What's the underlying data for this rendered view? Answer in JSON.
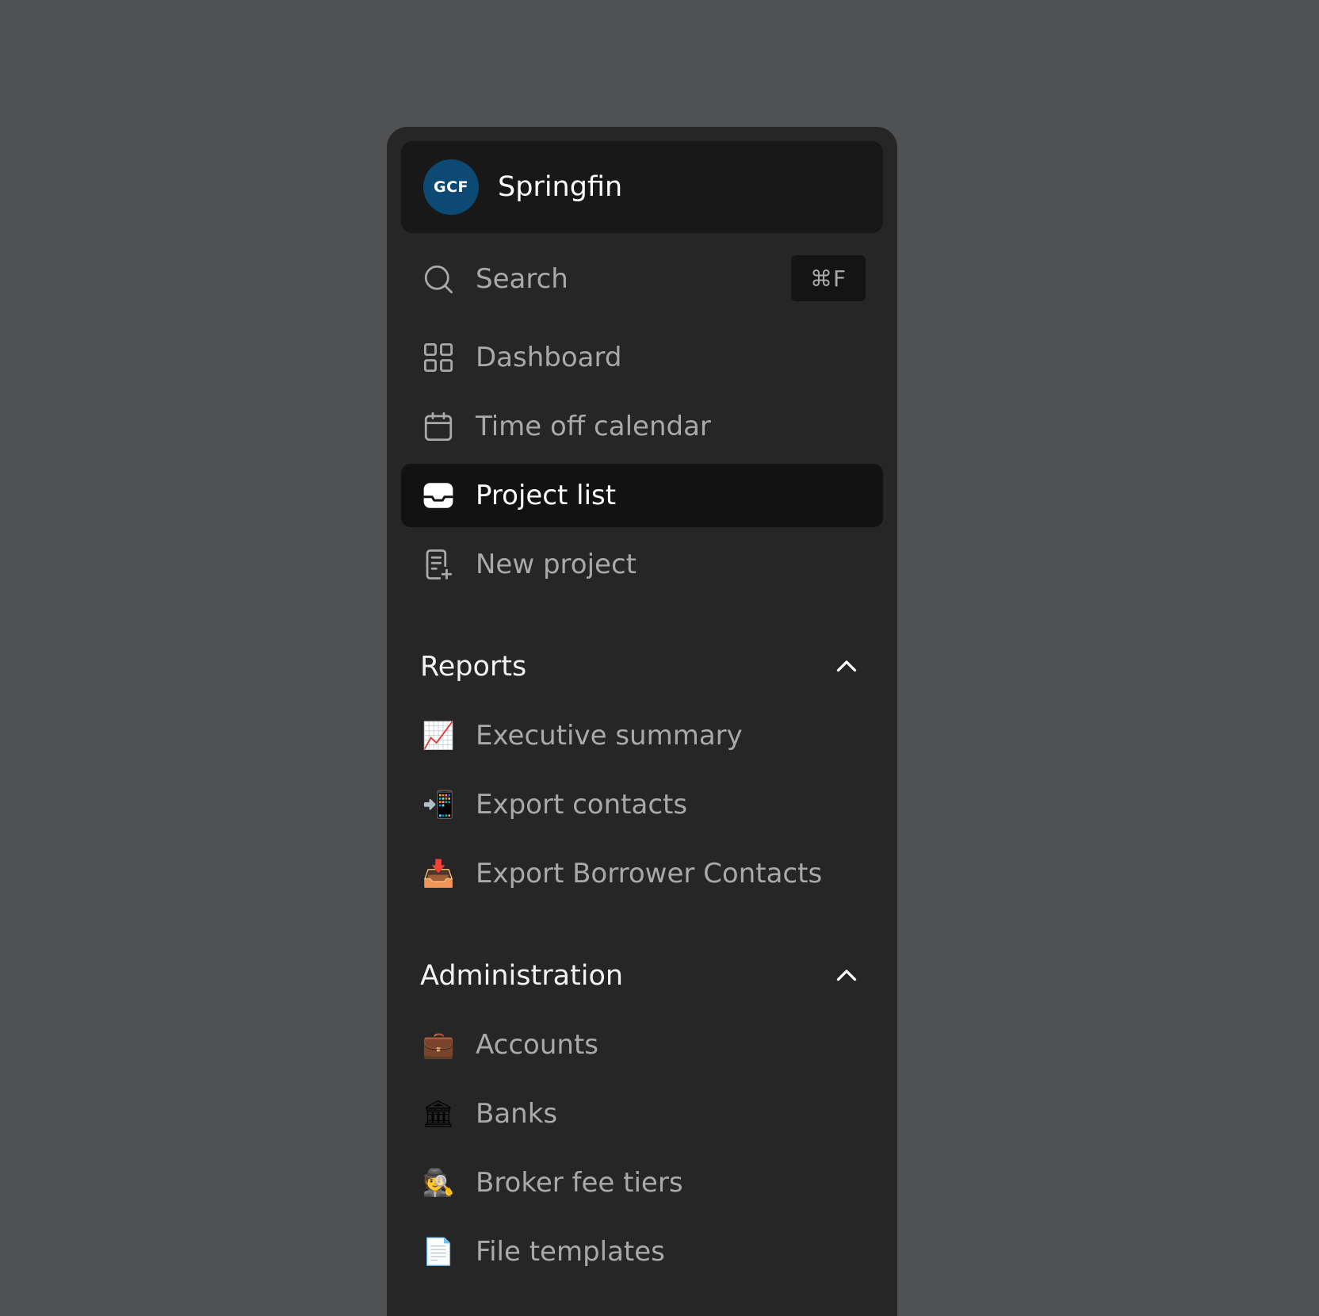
{
  "org": {
    "logo_text": "GCF",
    "name": "Springfin",
    "logo_color": "#0d4a73"
  },
  "search": {
    "placeholder": "Search",
    "shortcut": "⌘F",
    "icon": "search-icon"
  },
  "nav": {
    "items": [
      {
        "label": "Dashboard",
        "icon": "dashboard-grid-icon"
      },
      {
        "label": "Time off calendar",
        "icon": "calendar-icon"
      },
      {
        "label": "Project list",
        "icon": "inbox-tray-icon",
        "active": true
      },
      {
        "label": "New project",
        "icon": "document-add-icon"
      }
    ]
  },
  "reports": {
    "title": "Reports",
    "items": [
      {
        "label": "Executive summary",
        "emoji": "📈"
      },
      {
        "label": "Export contacts",
        "emoji": "📲"
      },
      {
        "label": "Export Borrower Contacts",
        "emoji": "📥"
      }
    ]
  },
  "administration": {
    "title": "Administration",
    "items": [
      {
        "label": "Accounts",
        "emoji": "💼"
      },
      {
        "label": "Banks",
        "emoji": "🏛"
      },
      {
        "label": "Broker fee tiers",
        "emoji": "🕵"
      },
      {
        "label": "File templates",
        "emoji": "📄"
      }
    ]
  },
  "colors": {
    "background": "#505153",
    "panel": "#262627",
    "header": "#181818",
    "active_row": "#121212",
    "muted_text": "#a9a9aa"
  }
}
